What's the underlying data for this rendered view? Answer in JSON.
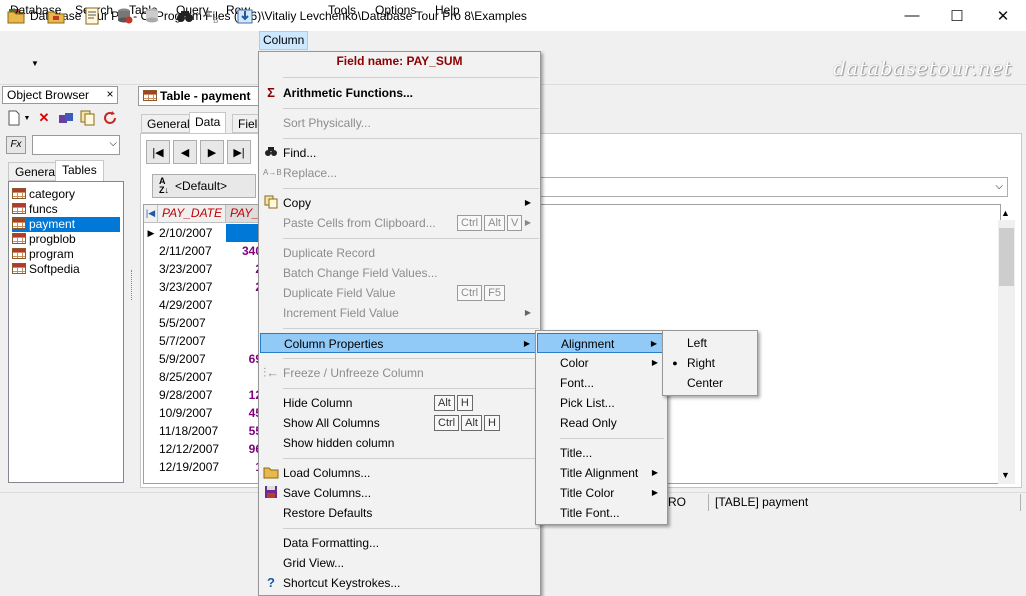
{
  "window": {
    "title": "Database Tour Pro - C:\\Program Files (x86)\\Vitaliy Levchenko\\Database Tour Pro 8\\Examples",
    "minimize": "—",
    "maximize": "☐",
    "close": "✕"
  },
  "menubar": [
    "Database",
    "Search",
    "Table",
    "Query",
    "Row",
    "Column",
    "Tools",
    "Options",
    "Help"
  ],
  "watermark": "databasetour.net",
  "left_panel": {
    "title": "Object Browser",
    "close": "×",
    "fx_label": "Fx",
    "tabs": [
      "General",
      "Tables"
    ],
    "tables": [
      "category",
      "funcs",
      "payment",
      "progblob",
      "program",
      "Softpedia"
    ],
    "selected_table": "payment"
  },
  "document": {
    "tab_title": "Table - payment",
    "tabs": [
      "General",
      "Data",
      "Fields"
    ],
    "sort_label": "<Default>",
    "columns": [
      "PAY_DATE",
      "PAY_SUM"
    ],
    "rows": [
      {
        "date": "2/10/2007",
        "sum": ""
      },
      {
        "date": "2/11/2007",
        "sum": "340"
      },
      {
        "date": "3/23/2007",
        "sum": "2"
      },
      {
        "date": "3/23/2007",
        "sum": "2"
      },
      {
        "date": "4/29/2007",
        "sum": ""
      },
      {
        "date": "5/5/2007",
        "sum": ""
      },
      {
        "date": "5/7/2007",
        "sum": ""
      },
      {
        "date": "5/9/2007",
        "sum": "69"
      },
      {
        "date": "8/25/2007",
        "sum": ""
      },
      {
        "date": "9/28/2007",
        "sum": "12"
      },
      {
        "date": "10/9/2007",
        "sum": "45"
      },
      {
        "date": "11/18/2007",
        "sum": "55"
      },
      {
        "date": "12/12/2007",
        "sum": "96"
      },
      {
        "date": "12/19/2007",
        "sum": "1"
      }
    ]
  },
  "statusbar": {
    "left_partial": "RO",
    "table": "[TABLE] payment"
  },
  "column_menu": {
    "header": "Field name: PAY_SUM",
    "items": {
      "arith": "Arithmetic Functions...",
      "sort": "Sort Physically...",
      "find": "Find...",
      "replace": "Replace...",
      "copy": "Copy",
      "paste": "Paste Cells from Clipboard...",
      "dup_record": "Duplicate Record",
      "batch": "Batch Change Field Values...",
      "dup_field": "Duplicate Field Value",
      "increment": "Increment Field Value",
      "col_props": "Column Properties",
      "freeze": "Freeze / Unfreeze Column",
      "hide": "Hide Column",
      "show_all": "Show All Columns",
      "show_hidden": "Show hidden column",
      "load": "Load Columns...",
      "save": "Save Columns...",
      "restore": "Restore Defaults",
      "formatting": "Data Formatting...",
      "grid_view": "Grid View...",
      "shortcuts": "Shortcut Keystrokes..."
    },
    "keys": {
      "ctrl": "Ctrl",
      "alt": "Alt",
      "v": "V",
      "f5": "F5",
      "h": "H"
    }
  },
  "column_props_menu": [
    "Alignment",
    "Color",
    "Font...",
    "Pick List...",
    "Read Only",
    "Title...",
    "Title Alignment",
    "Title Color",
    "Title Font..."
  ],
  "alignment_menu": {
    "items": [
      "Left",
      "Right",
      "Center"
    ],
    "checked": "Right"
  }
}
